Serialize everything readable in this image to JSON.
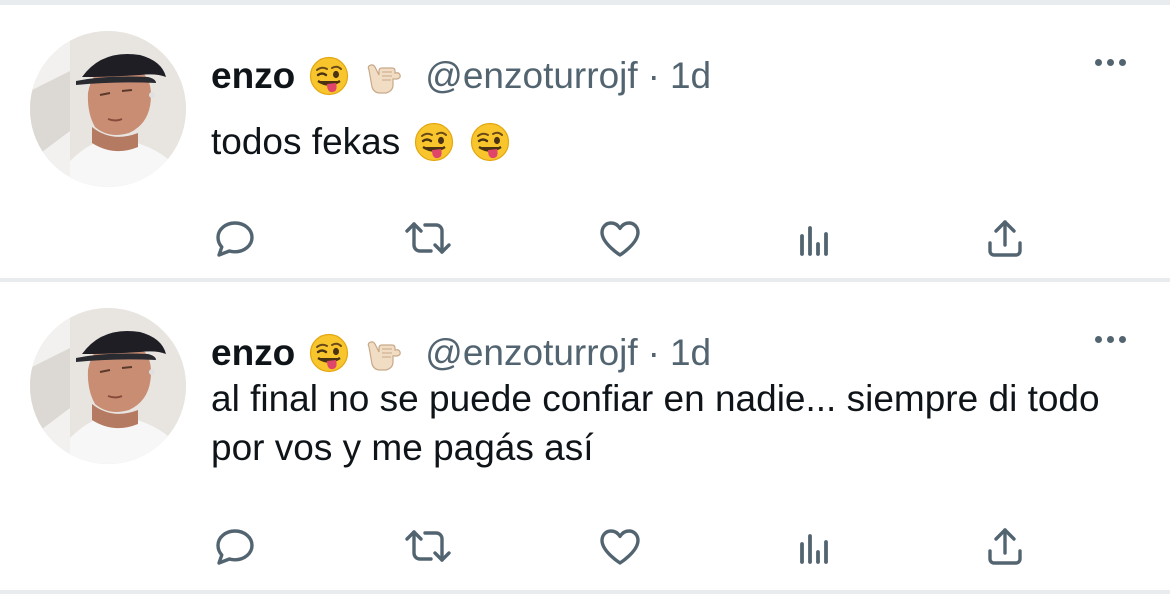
{
  "tweets": [
    {
      "name": "enzo",
      "handle": "@enzoturrojf",
      "separator": "·",
      "time": "1d",
      "text": "todos fekas",
      "header_emojis": [
        "winking-tongue-face-emoji",
        "call-me-hand-emoji"
      ],
      "text_emojis": [
        "winking-tongue-face-emoji",
        "winking-tongue-face-emoji"
      ]
    },
    {
      "name": "enzo",
      "handle": "@enzoturrojf",
      "separator": "·",
      "time": "1d",
      "text": "al final no se puede confiar en nadie... siempre di todo por vos y me pagás así",
      "header_emojis": [
        "winking-tongue-face-emoji",
        "call-me-hand-emoji"
      ]
    }
  ],
  "actions": [
    "reply-icon",
    "retweet-icon",
    "like-icon",
    "analytics-icon",
    "share-icon"
  ],
  "colors": {
    "icon": "#536471",
    "secondary_text": "#536471",
    "primary_text": "#0f1419",
    "divider": "#e9ecef"
  }
}
